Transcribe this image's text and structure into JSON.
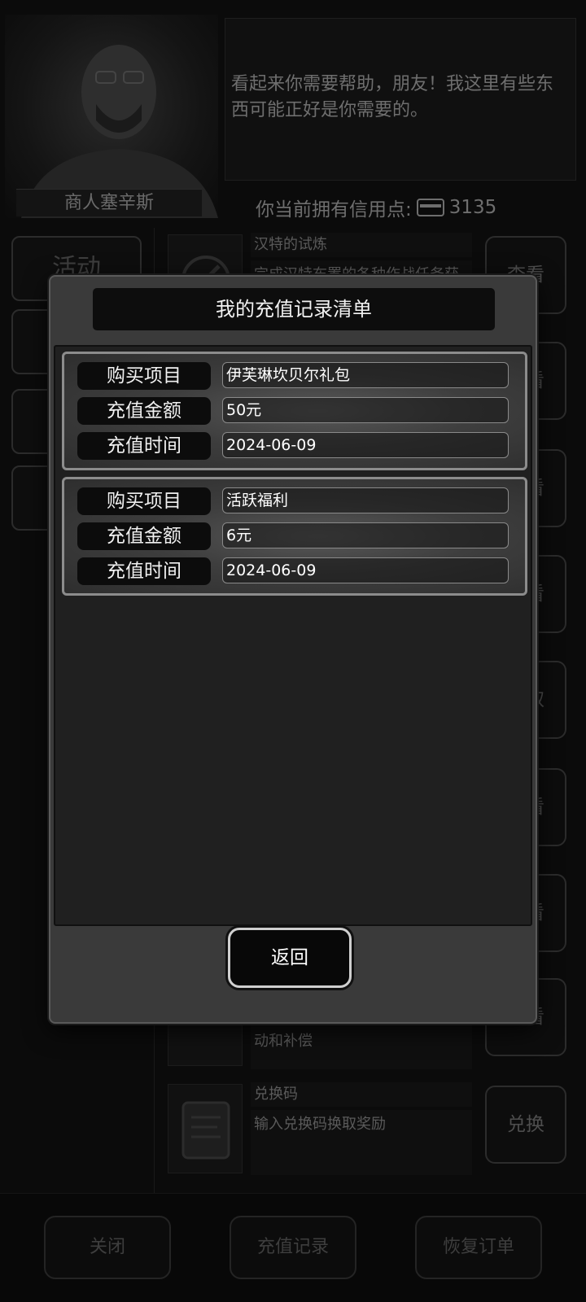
{
  "merchant": {
    "name": "商人塞辛斯",
    "dialogue": "看起来你需要帮助，朋友！我这里有些东西可能正好是你需要的。"
  },
  "credits": {
    "label": "你当前拥有信用点:",
    "value": "3135"
  },
  "left_tabs": [
    "活动"
  ],
  "list_items": [
    {
      "title": "汉特的试炼",
      "desc": "完成汉特布置的各种作战任务获",
      "button": "查看"
    },
    {
      "title": "",
      "desc": "",
      "button": "查看"
    },
    {
      "title": "",
      "desc": "",
      "button": "查看"
    },
    {
      "title": "",
      "desc": "",
      "button": "查看"
    },
    {
      "title": "",
      "desc": "",
      "button": "领取"
    },
    {
      "title": "",
      "desc": "",
      "button": "查看"
    },
    {
      "title": "",
      "desc": "",
      "button": "查看"
    },
    {
      "title": "",
      "desc": "黑骑士佣兵团发布的一些官方活动和补偿",
      "button": "查看"
    },
    {
      "title": "兑换码",
      "desc": "输入兑换码换取奖励",
      "button": "兑换"
    }
  ],
  "bottom_bar": {
    "close": "关闭",
    "recharge_records": "充值记录",
    "restore_orders": "恢复订单"
  },
  "modal": {
    "title": "我的充值记录清单",
    "records": [
      {
        "item_label": "购买项目",
        "item": "伊芙琳坎贝尔礼包",
        "amount_label": "充值金额",
        "amount": "50元",
        "time_label": "充值时间",
        "time": "2024-06-09"
      },
      {
        "item_label": "购买项目",
        "item": "活跃福利",
        "amount_label": "充值金额",
        "amount": "6元",
        "time_label": "充值时间",
        "time": "2024-06-09"
      }
    ],
    "back_button": "返回"
  }
}
